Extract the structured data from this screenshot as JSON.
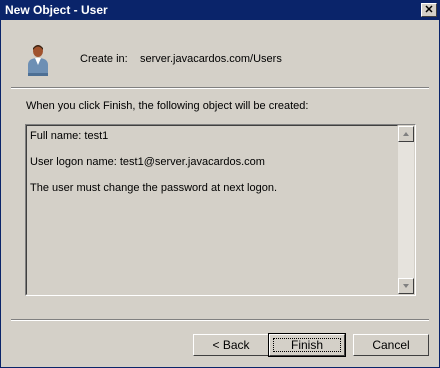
{
  "window": {
    "title": "New Object - User",
    "close_glyph": "✕"
  },
  "header": {
    "create_in_label": "Create in:",
    "create_in_path": "server.javacardos.com/Users",
    "icon": "user-icon"
  },
  "instruction": "When you click Finish, the following object will be created:",
  "summary": {
    "lines": [
      "Full name: test1",
      "User logon name: test1@server.javacardos.com",
      "The user must change the password at next logon."
    ]
  },
  "buttons": {
    "back": "< Back",
    "finish": "Finish",
    "cancel": "Cancel"
  }
}
